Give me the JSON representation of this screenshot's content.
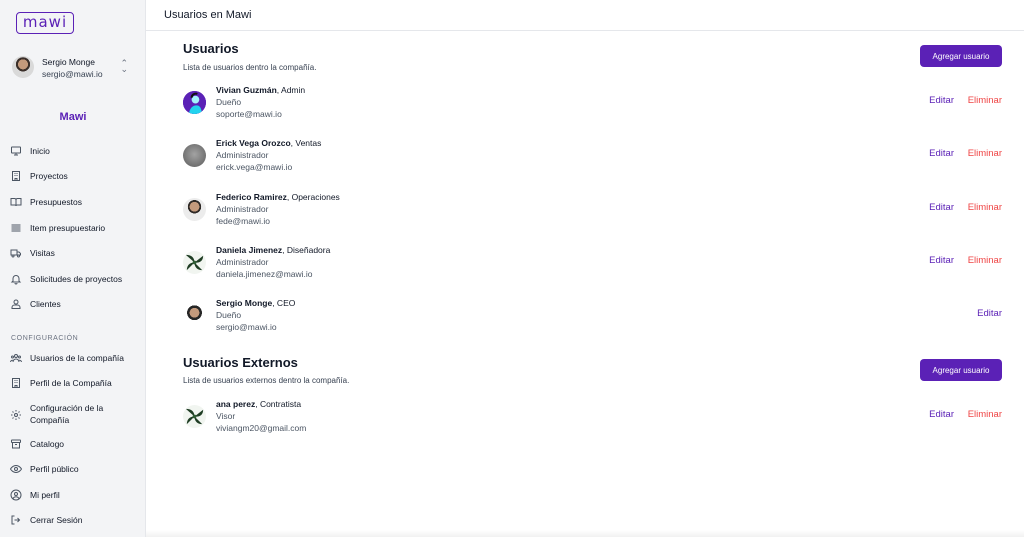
{
  "app": {
    "logo_text": "mawi",
    "company_name": "Mawi",
    "accent_color": "#5b21b6",
    "danger_color": "#ef4444"
  },
  "current_user": {
    "name": "Sergio Monge",
    "email": "sergio@mawi.io"
  },
  "sidebar": {
    "items": [
      {
        "label": "Inicio",
        "icon": "monitor-icon"
      },
      {
        "label": "Proyectos",
        "icon": "building-icon"
      },
      {
        "label": "Presupuestos",
        "icon": "book-open-icon"
      },
      {
        "label": "Item presupuestario",
        "icon": "list-icon"
      },
      {
        "label": "Visitas",
        "icon": "truck-icon"
      },
      {
        "label": "Solicitudes de proyectos",
        "icon": "bell-icon"
      },
      {
        "label": "Clientes",
        "icon": "users-icon"
      }
    ],
    "config_label": "CONFIGURACIÓN",
    "config_items": [
      {
        "label": "Usuarios de la compañía",
        "icon": "user-group-icon"
      },
      {
        "label": "Perfil de la Compañía",
        "icon": "office-building-icon"
      },
      {
        "label_line1": "Configuración de la",
        "label_line2": "Compañía",
        "icon": "cog-icon"
      },
      {
        "label": "Catalogo",
        "icon": "archive-icon"
      },
      {
        "label": "Perfil público",
        "icon": "eye-icon"
      },
      {
        "label": "Mi perfil",
        "icon": "user-circle-icon"
      },
      {
        "label": "Cerrar Sesión",
        "icon": "logout-icon"
      }
    ]
  },
  "header": {
    "title": "Usuarios en Mawi"
  },
  "users_section": {
    "title": "Usuarios",
    "description": "Lista de usuarios dentro la compañía.",
    "add_button": "Agregar usuario",
    "users": [
      {
        "name": "Vivian Guzmán",
        "role_suffix": ", Admin",
        "type": "Dueño",
        "email": "soporte@mawi.io",
        "edit": "Editar",
        "delete": "Eliminar"
      },
      {
        "name": "Erick Vega Orozco",
        "role_suffix": ", Ventas",
        "type": "Administrador",
        "email": "erick.vega@mawi.io",
        "edit": "Editar",
        "delete": "Eliminar"
      },
      {
        "name": "Federico Ramirez",
        "role_suffix": ", Operaciones",
        "type": "Administrador",
        "email": "fede@mawi.io",
        "edit": "Editar",
        "delete": "Eliminar"
      },
      {
        "name": "Daniela Jimenez",
        "role_suffix": ", Diseñadora",
        "type": "Administrador",
        "email": "daniela.jimenez@mawi.io",
        "edit": "Editar",
        "delete": "Eliminar"
      },
      {
        "name": "Sergio Monge",
        "role_suffix": ", CEO",
        "type": "Dueño",
        "email": "sergio@mawi.io",
        "edit": "Editar"
      }
    ]
  },
  "external_section": {
    "title": "Usuarios Externos",
    "description": "Lista de usuarios externos dentro la compañía.",
    "add_button": "Agregar usuario",
    "users": [
      {
        "name": "ana perez",
        "role_suffix": ", Contratista",
        "type": "Visor",
        "email": "viviangm20@gmail.com",
        "edit": "Editar",
        "delete": "Eliminar"
      }
    ]
  }
}
